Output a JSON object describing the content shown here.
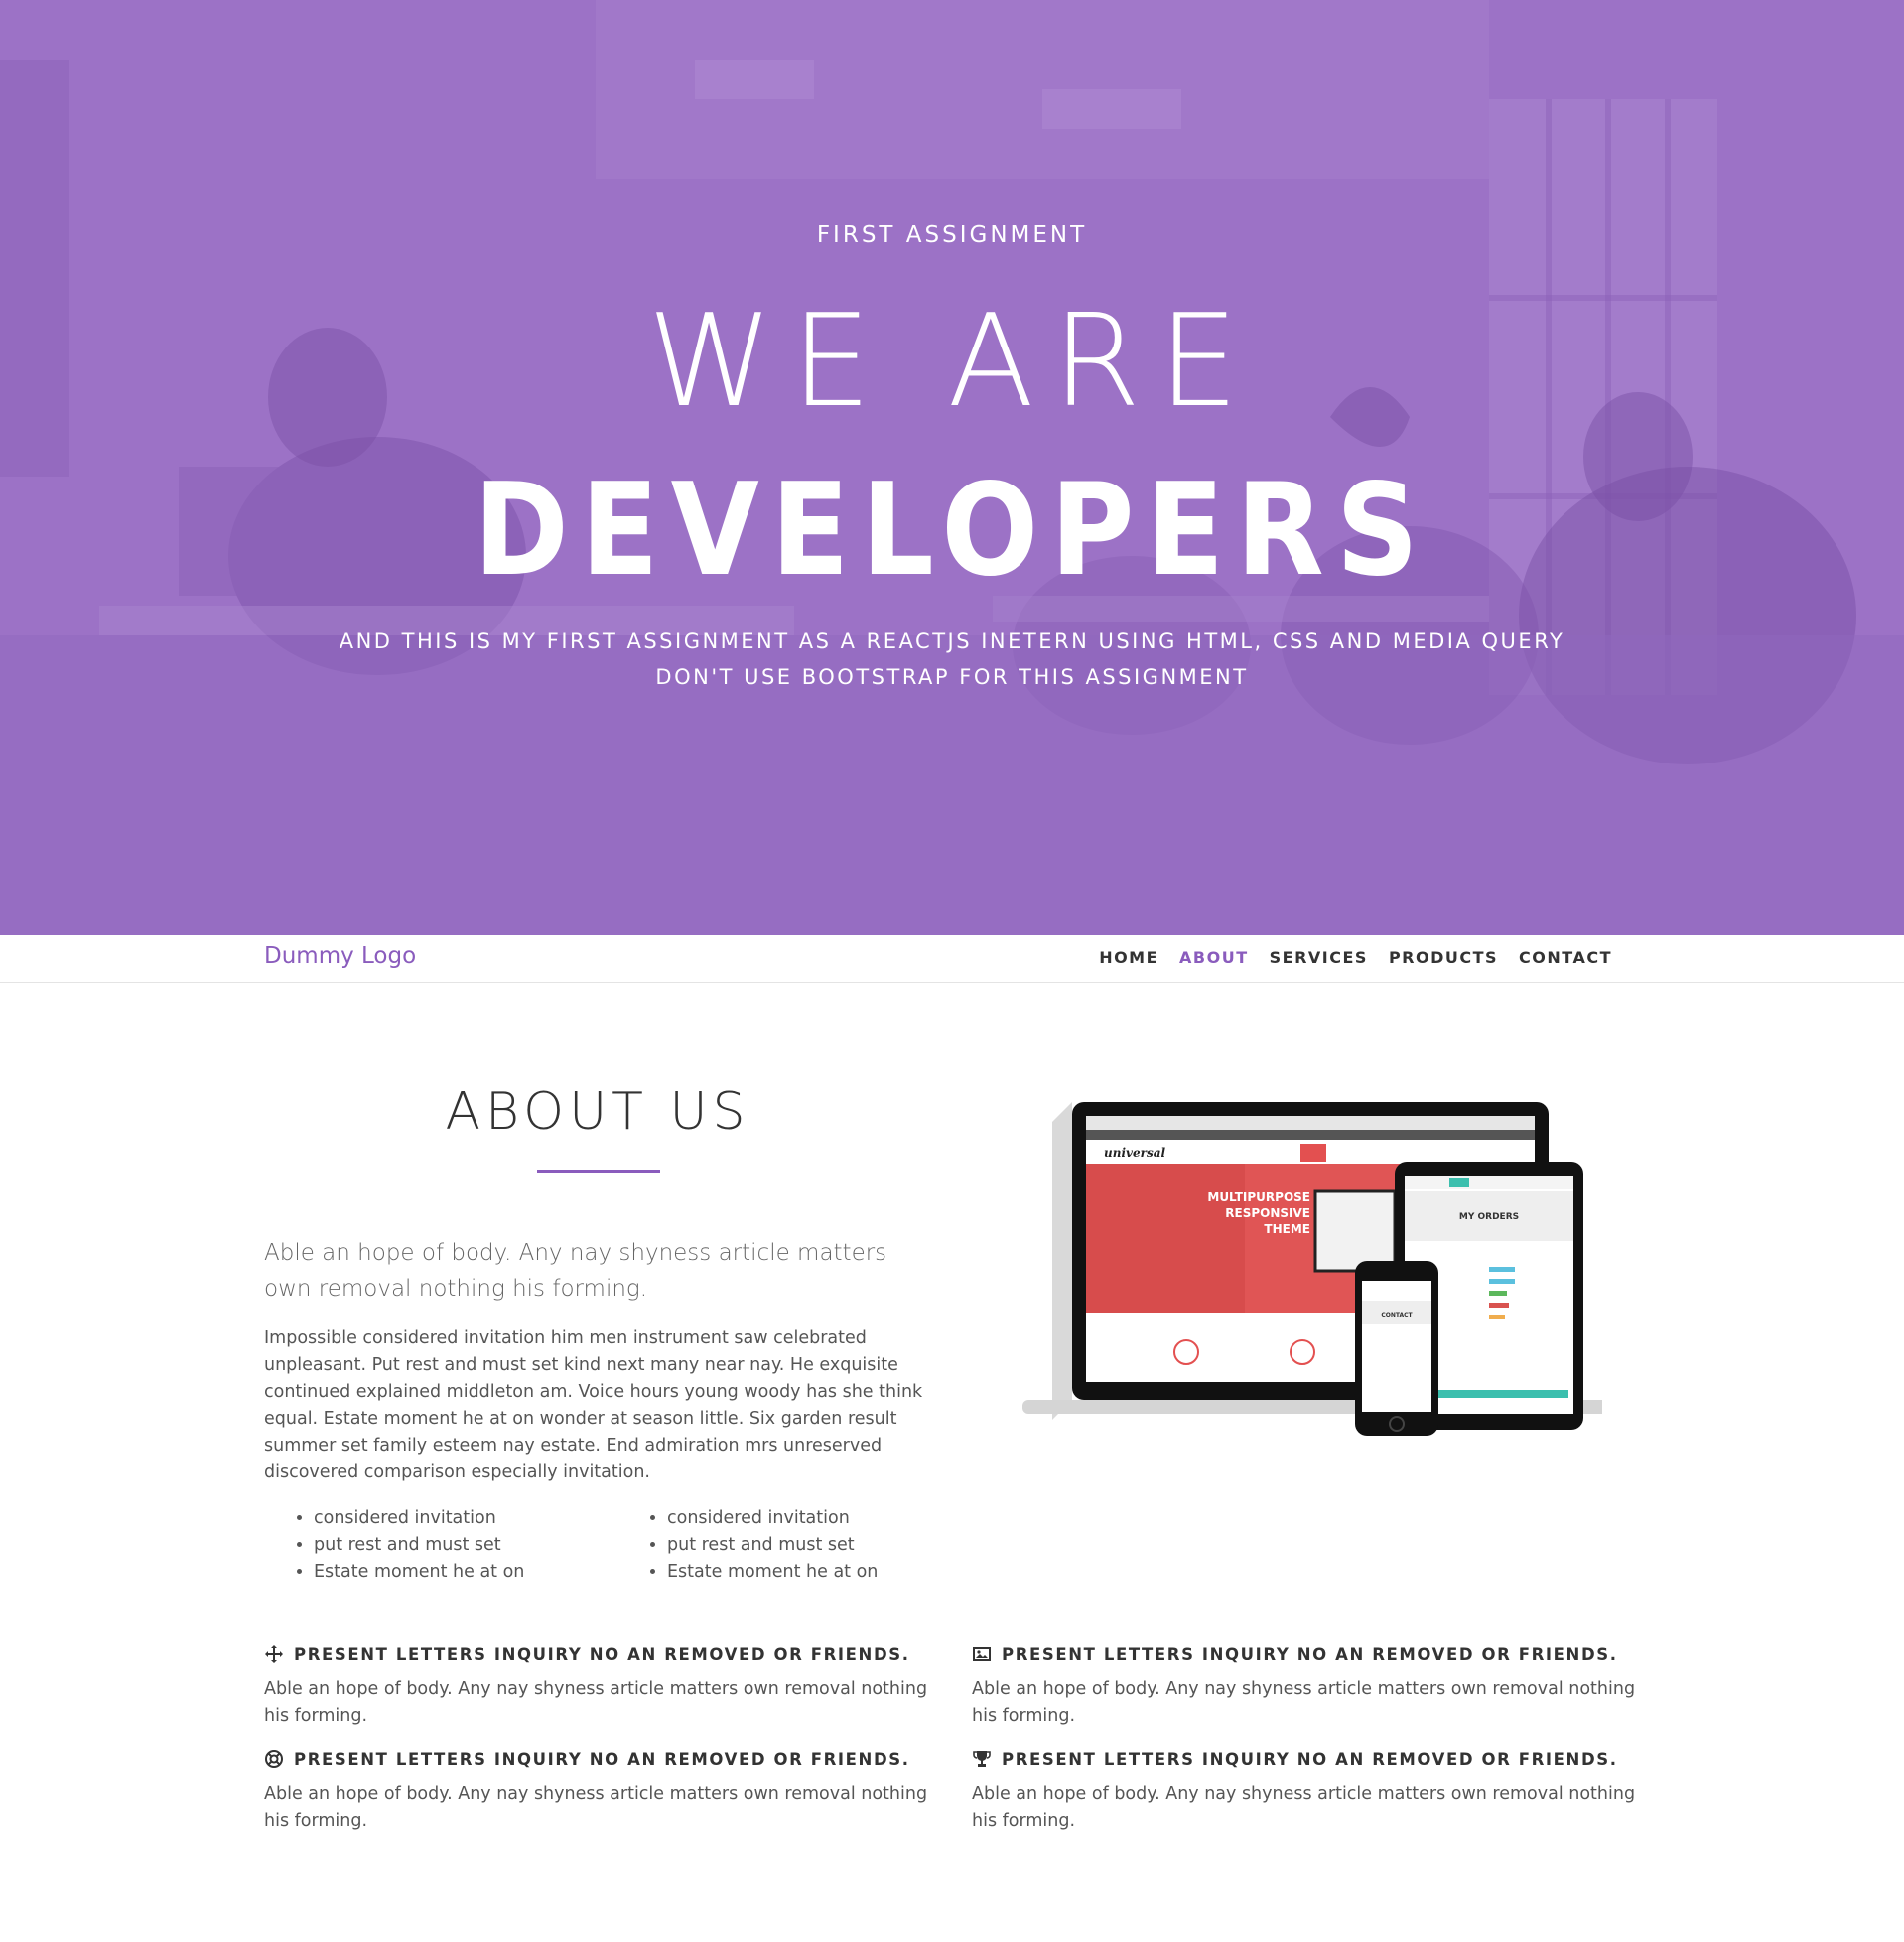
{
  "hero": {
    "eyebrow": "FIRST ASSIGNMENT",
    "line1": "WE ARE",
    "line2": "DEVELOPERS",
    "sub_line1": "AND THIS IS MY FIRST ASSIGNMENT AS A REACTJS INETERN USING HTML, CSS AND MEDIA QUERY",
    "sub_line2": "DON'T USE BOOTSTRAP FOR THIS ASSIGNMENT",
    "overlay_color": "#9c72c6"
  },
  "nav": {
    "logo": "Dummy Logo",
    "links": [
      {
        "label": "HOME",
        "active": false
      },
      {
        "label": "ABOUT",
        "active": true
      },
      {
        "label": "SERVICES",
        "active": false
      },
      {
        "label": "PRODUCTS",
        "active": false
      },
      {
        "label": "CONTACT",
        "active": false
      }
    ],
    "accent_color": "#8a5cbd"
  },
  "about": {
    "title": "ABOUT US",
    "lead": "Able an hope of body. Any nay shyness article matters own removal nothing his forming.",
    "body": "Impossible considered invitation him men instrument saw celebrated unpleasant. Put rest and must set kind next many near nay. He exquisite continued explained middleton am. Voice hours young woody has she think equal. Estate moment he at on wonder at season little. Six garden result summer set family esteem nay estate. End admiration mrs unreserved discovered comparison especially invitation.",
    "list_left": [
      "considered invitation",
      "put rest and must set",
      "Estate moment he at on"
    ],
    "list_right": [
      "considered invitation",
      "put rest and must set",
      "Estate moment he at on"
    ]
  },
  "devices": {
    "brand": "universal",
    "hero_title": "MULTIPURPOSE RESPONSIVE THEME",
    "tablet_heading": "MY ORDERS",
    "phone_heading": "CONTACT"
  },
  "features": [
    {
      "icon": "arrows-move-icon",
      "title": "PRESENT LETTERS INQUIRY NO AN REMOVED OR FRIENDS.",
      "text": "Able an hope of body. Any nay shyness article matters own removal nothing his forming."
    },
    {
      "icon": "image-icon",
      "title": "PRESENT LETTERS INQUIRY NO AN REMOVED OR FRIENDS.",
      "text": "Able an hope of body. Any nay shyness article matters own removal nothing his forming."
    },
    {
      "icon": "lifebuoy-icon",
      "title": "PRESENT LETTERS INQUIRY NO AN REMOVED OR FRIENDS.",
      "text": "Able an hope of body. Any nay shyness article matters own removal nothing his forming."
    },
    {
      "icon": "trophy-icon",
      "title": "PRESENT LETTERS INQUIRY NO AN REMOVED OR FRIENDS.",
      "text": "Able an hope of body. Any nay shyness article matters own removal nothing his forming."
    }
  ]
}
